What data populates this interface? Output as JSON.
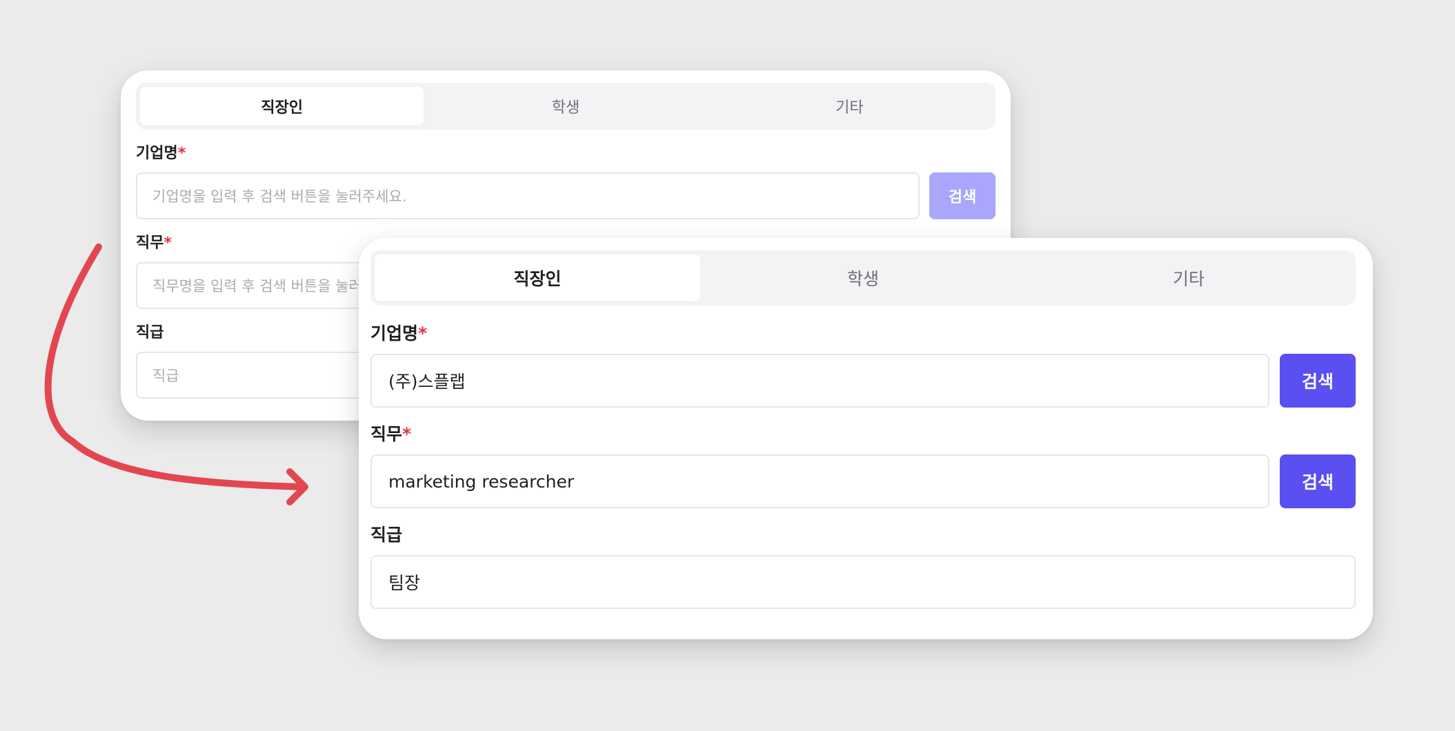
{
  "colors": {
    "background": "#ebebec",
    "accent": "#5a4ff1",
    "accent_disabled": "#a9a6fb",
    "required_star": "#e0343d",
    "arrow": "#e2474f"
  },
  "tabs": [
    "직장인",
    "학생",
    "기타"
  ],
  "required_mark": "*",
  "back_form": {
    "company": {
      "label": "기업명",
      "placeholder": "기업명을 입력 후 검색 버튼을 눌러주세요.",
      "button": "검색"
    },
    "job": {
      "label": "직무",
      "placeholder": "직무명을 입력 후 검색 버튼을 눌러주세요."
    },
    "position": {
      "label": "직급",
      "placeholder": "직급"
    }
  },
  "front_form": {
    "company": {
      "label": "기업명",
      "value": "(주)스플랩",
      "button": "검색"
    },
    "job": {
      "label": "직무",
      "value": "marketing researcher",
      "button": "검색"
    },
    "position": {
      "label": "직급",
      "value": "팀장"
    }
  }
}
